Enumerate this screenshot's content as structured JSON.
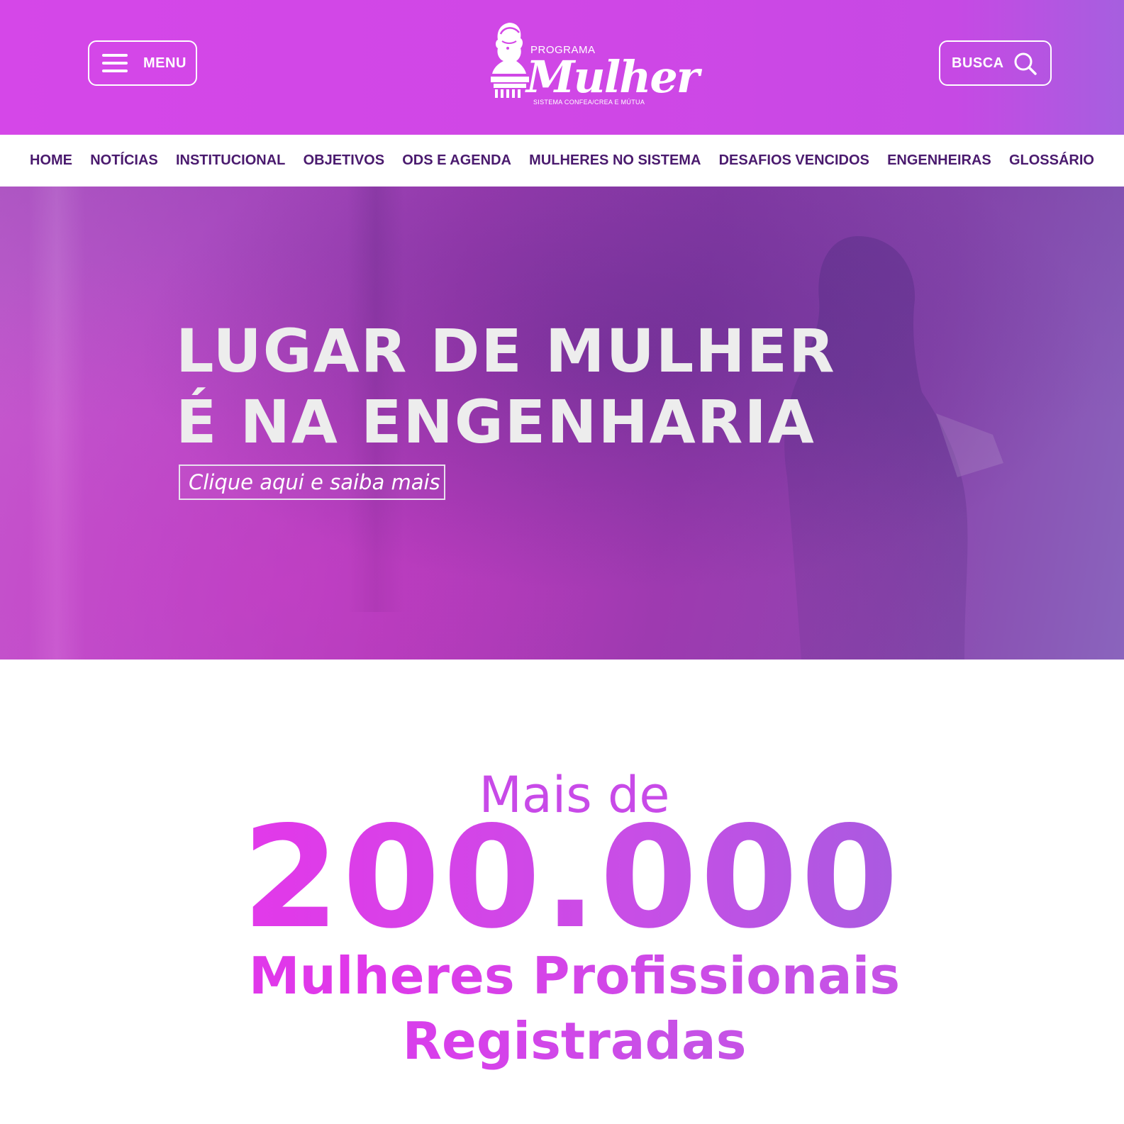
{
  "header": {
    "menu_label": "MENU",
    "search_label": "BUSCA",
    "logo": {
      "program_text": "PROGRAMA",
      "name_text": "Mulher",
      "sub_text": "SISTEMA CONFEA/CREA E MÚTUA"
    },
    "colors": {
      "background_start": "#d547e8",
      "background_end": "#a65fdf"
    }
  },
  "nav": {
    "items": [
      {
        "label": "HOME"
      },
      {
        "label": "NOTÍCIAS"
      },
      {
        "label": "INSTITUCIONAL"
      },
      {
        "label": "OBJETIVOS"
      },
      {
        "label": "ODS E AGENDA"
      },
      {
        "label": "MULHERES NO SISTEMA"
      },
      {
        "label": "DESAFIOS VENCIDOS"
      },
      {
        "label": "ENGENHEIRAS"
      },
      {
        "label": "GLOSSÁRIO"
      }
    ],
    "text_color": "#4a1a6e"
  },
  "hero": {
    "title_line1": "LUGAR DE MULHER",
    "title_line2": "É NA ENGENHARIA",
    "cta_label": "Clique aqui e saiba mais"
  },
  "stats": {
    "prefix": "Mais de",
    "number": "200.000",
    "line1": "Mulheres Profissionais",
    "line2": "Registradas"
  },
  "icons": {
    "menu": "hamburger-icon",
    "search": "search-icon"
  }
}
